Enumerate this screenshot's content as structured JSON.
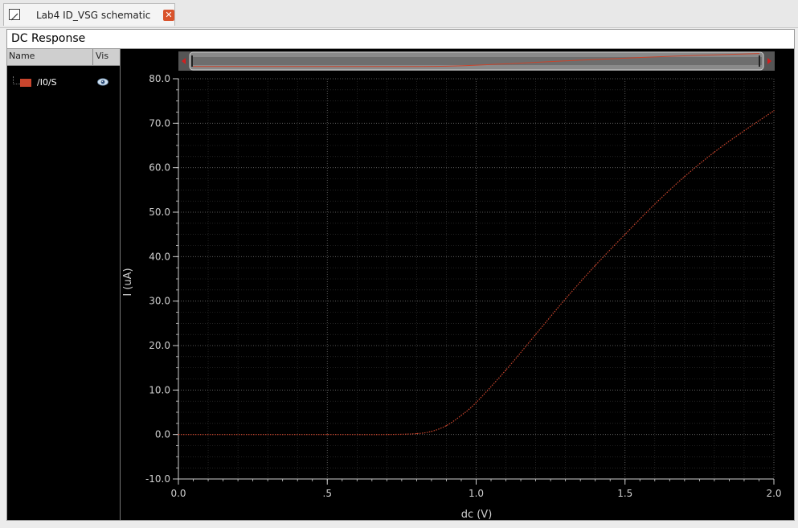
{
  "tab": {
    "label": "Lab4 ID_VSG schematic",
    "close_symbol": "✕"
  },
  "window": {
    "title": "DC Response"
  },
  "legend": {
    "col_name": "Name",
    "col_vis": "Vis",
    "items": [
      {
        "label": "/I0/S",
        "color": "#c8452d",
        "icon": "eye-icon"
      }
    ]
  },
  "chart_data": {
    "type": "line",
    "xlabel": "dc (V)",
    "ylabel": "I (uA)",
    "xlim": [
      0.0,
      2.0
    ],
    "ylim": [
      -10.0,
      80.0
    ],
    "x_ticks": [
      0.0,
      0.5,
      1.0,
      1.5,
      2.0
    ],
    "x_tick_labels": [
      "0.0",
      ".5",
      "1.0",
      "1.5",
      "2.0"
    ],
    "y_ticks": [
      -10,
      0,
      10,
      20,
      30,
      40,
      50,
      60,
      70,
      80
    ],
    "y_tick_labels": [
      "-10.0",
      "0.0",
      "10.0",
      "20.0",
      "30.0",
      "40.0",
      "50.0",
      "60.0",
      "70.0",
      "80.0"
    ],
    "grid": true,
    "background": "#000000",
    "series": [
      {
        "name": "/I0/S",
        "color": "#c8452d",
        "x": [
          0.0,
          0.5,
          0.7,
          0.8,
          0.85,
          0.9,
          0.95,
          1.0,
          1.1,
          1.2,
          1.3,
          1.4,
          1.5,
          1.6,
          1.7,
          1.8,
          1.9,
          2.0
        ],
        "y": [
          0.0,
          0.0,
          0.0,
          0.2,
          0.7,
          2.0,
          4.3,
          7.2,
          14.5,
          22.5,
          30.5,
          38.0,
          45.0,
          51.8,
          58.0,
          63.5,
          68.3,
          72.8
        ]
      }
    ],
    "overview_bar": true
  }
}
